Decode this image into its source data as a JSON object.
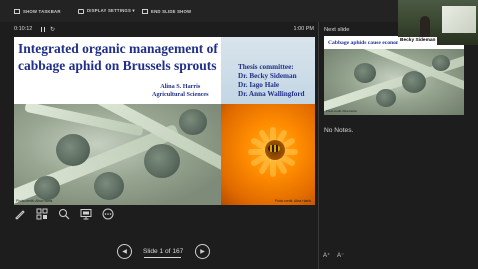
{
  "toolbar": {
    "show_taskbar": "SHOW TASKBAR",
    "display_settings": "DISPLAY SETTINGS ▾",
    "end_slide_show": "END SLIDE SHOW"
  },
  "timer": {
    "elapsed": "0:10:12",
    "clock": "1:00 PM"
  },
  "slide": {
    "title": "Integrated organic management of cabbage aphid on Brussels sprouts",
    "author_name": "Alina S. Harris",
    "author_dept": "Agricultural Sciences",
    "committee_heading": "Thesis committee:",
    "committee_members": [
      "Dr. Becky Sideman",
      "Dr. Iago Hale",
      "Dr. Anna Wallingford"
    ],
    "credit_left": "Photo credit: Alina Harris",
    "credit_right": "Photo credit: Alina Harris"
  },
  "navigation": {
    "label": "Slide 1 of 167",
    "prev_icon": "prev-arrow-icon",
    "next_icon": "next-arrow-icon"
  },
  "next_slide": {
    "label": "Next slide",
    "title": "Cabbage aphids cause economic damage to...",
    "credit": "Photo credit: Alina Harris"
  },
  "notes": "No Notes.",
  "font_buttons": {
    "increase": "A⁺",
    "decrease": "A⁻"
  },
  "webcam": {
    "name": "Becky Sideman"
  },
  "colors": {
    "title_blue": "#1f2f8a",
    "background": "#1d1d1d"
  }
}
